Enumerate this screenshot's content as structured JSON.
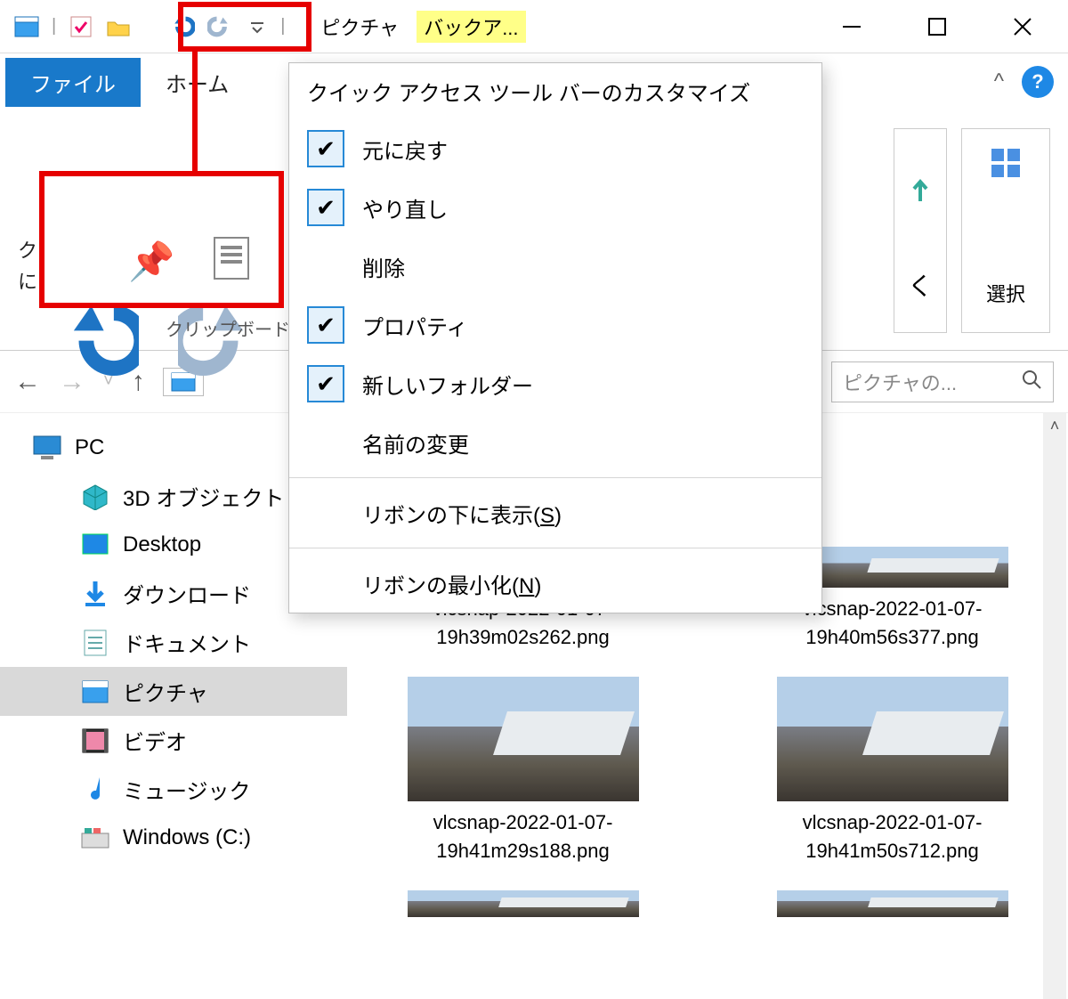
{
  "titlebar": {
    "title": "ピクチャ",
    "highlight": "バックア..."
  },
  "ribbon": {
    "tab_file": "ファイル",
    "tab_home": "ホーム",
    "left_txt1": "ク",
    "left_txt2": "に",
    "group_clipboard": "クリップボード",
    "peek_ku": "く",
    "select_label": "選択"
  },
  "qat_menu": {
    "header": "クイック アクセス ツール バーのカスタマイズ",
    "items": [
      {
        "checked": true,
        "label": "元に戻す"
      },
      {
        "checked": true,
        "label": "やり直し"
      },
      {
        "checked": false,
        "label": "削除"
      },
      {
        "checked": true,
        "label": "プロパティ"
      },
      {
        "checked": true,
        "label": "新しいフォルダー"
      },
      {
        "checked": false,
        "label": "名前の変更"
      }
    ],
    "below_ribbon_pre": "リボンの下に表示(",
    "below_ribbon_key": "S",
    "below_ribbon_post": ")",
    "minimize_pre": "リボンの最小化(",
    "minimize_key": "N",
    "minimize_post": ")"
  },
  "navbar": {
    "search_placeholder": "ピクチャの..."
  },
  "sidebar": {
    "pc": "PC",
    "items": [
      "3D オブジェクト",
      "Desktop",
      "ダウンロード",
      "ドキュメント",
      "ピクチャ",
      "ビデオ",
      "ミュージック",
      "Windows (C:)"
    ]
  },
  "files": [
    "vlcsnap-2022-01-07-19h39m02s262.png",
    "vlcsnap-2022-01-07-19h40m56s377.png",
    "vlcsnap-2022-01-07-19h41m29s188.png",
    "vlcsnap-2022-01-07-19h41m50s712.png"
  ]
}
